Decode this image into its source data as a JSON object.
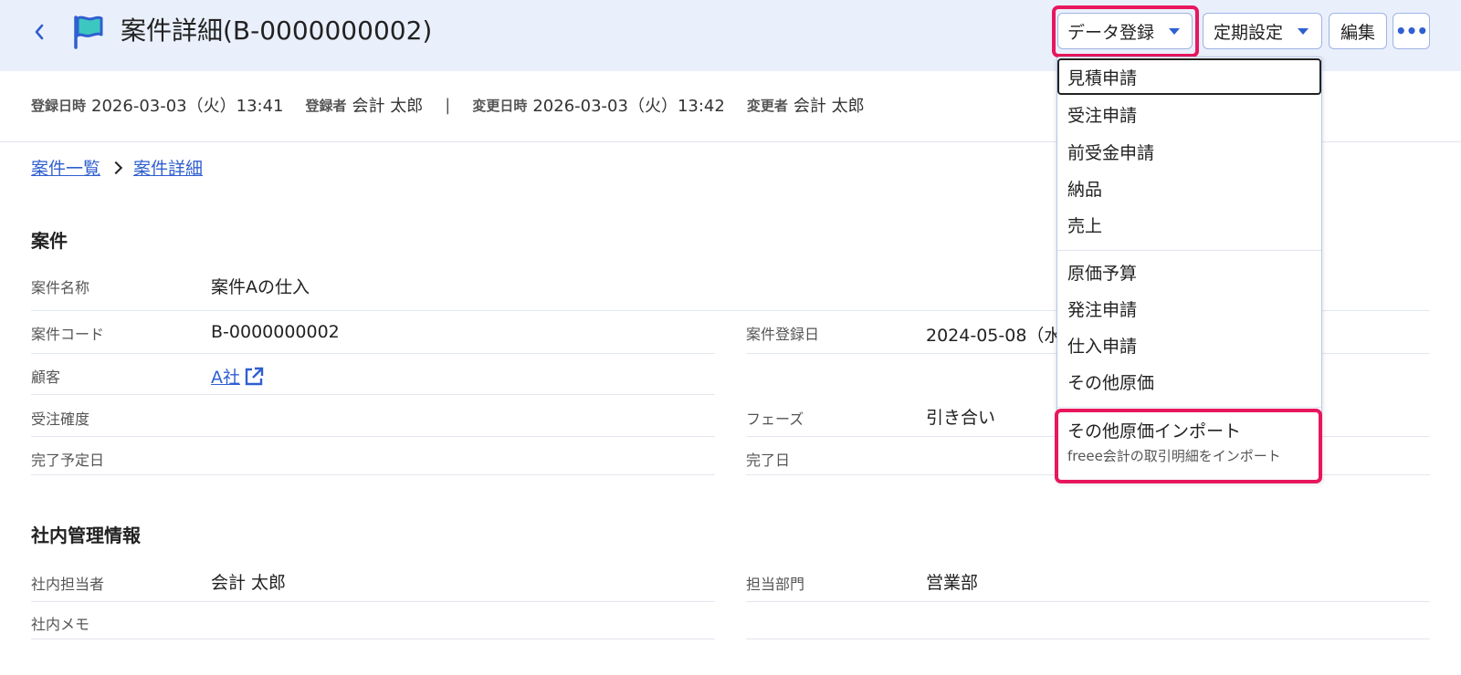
{
  "header": {
    "title": "案件詳細(B-0000000002)",
    "buttons": {
      "data_register": "データ登録",
      "periodic": "定期設定",
      "edit": "編集",
      "more": "•••"
    }
  },
  "meta": {
    "registered_label": "登録日時",
    "registered_value": "2026-03-03（火）13:41",
    "registrant_label": "登録者",
    "registrant_value": "会計 太郎",
    "separator": "|",
    "modified_label": "変更日時",
    "modified_value": "2026-03-03（火）13:42",
    "modifier_label": "変更者",
    "modifier_value": "会計 太郎"
  },
  "breadcrumb": {
    "items": [
      "案件一覧",
      "案件詳細"
    ]
  },
  "project": {
    "title": "案件",
    "name_label": "案件名称",
    "name_value": "案件Aの仕入",
    "code_label": "案件コード",
    "code_value": "B-0000000002",
    "reg_date_label": "案件登録日",
    "reg_date_value": "2024-05-08（水",
    "customer_label": "顧客",
    "customer_value": "A社",
    "certainty_label": "受注確度",
    "phase_label": "フェーズ",
    "phase_value": "引き合い",
    "planned_label": "完了予定日",
    "done_label": "完了日"
  },
  "internal": {
    "title": "社内管理情報",
    "owner_label": "社内担当者",
    "owner_value": "会計 太郎",
    "dept_label": "担当部門",
    "dept_value": "営業部",
    "memo_label": "社内メモ"
  },
  "dropdown": {
    "items": [
      "見積申請",
      "受注申請",
      "前受金申請",
      "納品",
      "売上",
      "原価予算",
      "発注申請",
      "仕入申請",
      "その他原価",
      "その他原価インポート"
    ],
    "import_sub": "freee会計の取引明細をインポート"
  },
  "colors": {
    "accent": "#2f5fd0",
    "highlight": "#e8175d",
    "header_bg": "#eaf0fb",
    "flag": "#3cc8c0"
  },
  "icons": {
    "back": "chevron-left-icon",
    "flag": "flag-icon",
    "external": "external-link-icon",
    "caret": "caret-down-icon",
    "more": "more-icon"
  }
}
